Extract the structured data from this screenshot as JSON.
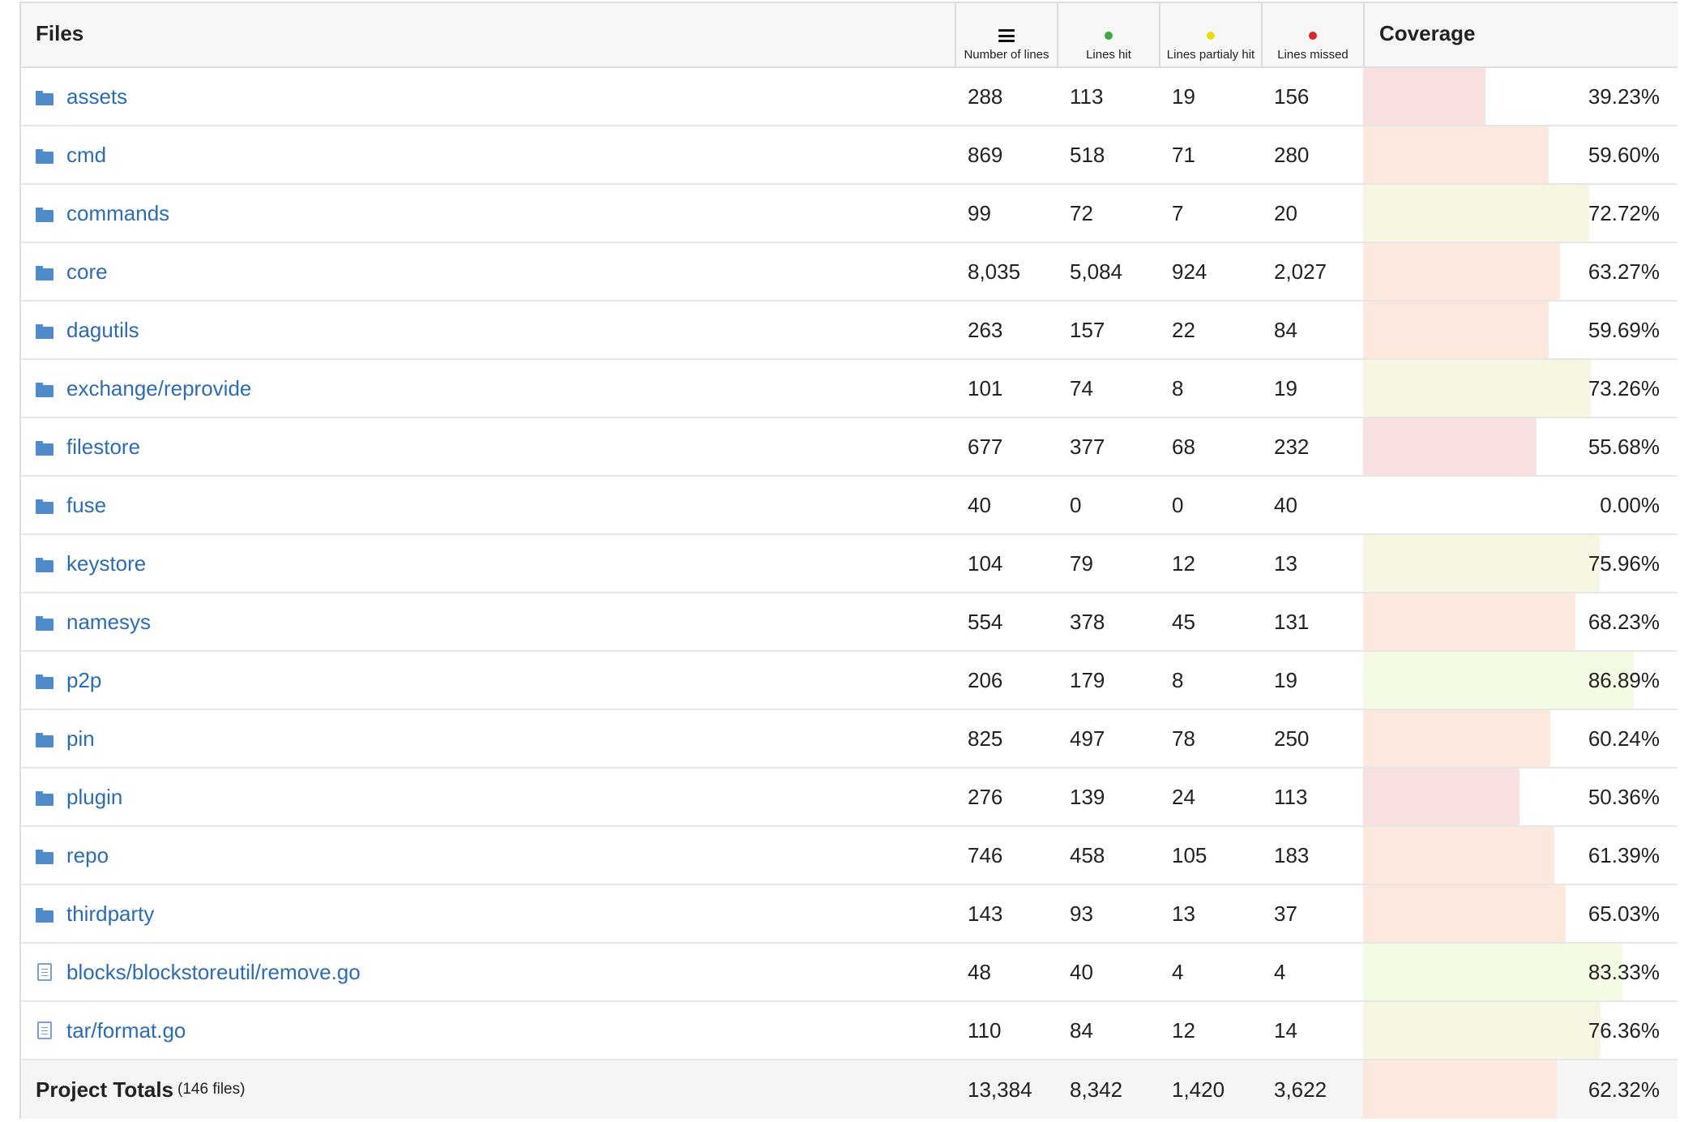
{
  "header": {
    "files": "Files",
    "number_of_lines": "Number of lines",
    "lines_hit": "Lines hit",
    "lines_partial": "Lines partialy hit",
    "lines_missed": "Lines missed",
    "coverage": "Coverage"
  },
  "colors": {
    "hit_dot": "#3aa83a",
    "partial_dot": "#f2d80e",
    "missed_dot": "#e02525",
    "link": "#2d6cb0",
    "bar_low": "#f8e0e0",
    "bar_mid": "#fde8de",
    "bar_high": "#f7f6e2",
    "bar_good": "#f3fbe4"
  },
  "rows": [
    {
      "icon": "folder-icon",
      "name": "assets",
      "lines": "288",
      "hit": "113",
      "partial": "19",
      "missed": "156",
      "coverage": "39.23%",
      "pct": 39.23
    },
    {
      "icon": "folder-icon",
      "name": "cmd",
      "lines": "869",
      "hit": "518",
      "partial": "71",
      "missed": "280",
      "coverage": "59.60%",
      "pct": 59.6
    },
    {
      "icon": "folder-icon",
      "name": "commands",
      "lines": "99",
      "hit": "72",
      "partial": "7",
      "missed": "20",
      "coverage": "72.72%",
      "pct": 72.72
    },
    {
      "icon": "folder-icon",
      "name": "core",
      "lines": "8,035",
      "hit": "5,084",
      "partial": "924",
      "missed": "2,027",
      "coverage": "63.27%",
      "pct": 63.27
    },
    {
      "icon": "folder-icon",
      "name": "dagutils",
      "lines": "263",
      "hit": "157",
      "partial": "22",
      "missed": "84",
      "coverage": "59.69%",
      "pct": 59.69
    },
    {
      "icon": "folder-icon",
      "name": "exchange/reprovide",
      "lines": "101",
      "hit": "74",
      "partial": "8",
      "missed": "19",
      "coverage": "73.26%",
      "pct": 73.26
    },
    {
      "icon": "folder-icon",
      "name": "filestore",
      "lines": "677",
      "hit": "377",
      "partial": "68",
      "missed": "232",
      "coverage": "55.68%",
      "pct": 55.68
    },
    {
      "icon": "folder-icon",
      "name": "fuse",
      "lines": "40",
      "hit": "0",
      "partial": "0",
      "missed": "40",
      "coverage": "0.00%",
      "pct": 0
    },
    {
      "icon": "folder-icon",
      "name": "keystore",
      "lines": "104",
      "hit": "79",
      "partial": "12",
      "missed": "13",
      "coverage": "75.96%",
      "pct": 75.96
    },
    {
      "icon": "folder-icon",
      "name": "namesys",
      "lines": "554",
      "hit": "378",
      "partial": "45",
      "missed": "131",
      "coverage": "68.23%",
      "pct": 68.23
    },
    {
      "icon": "folder-icon",
      "name": "p2p",
      "lines": "206",
      "hit": "179",
      "partial": "8",
      "missed": "19",
      "coverage": "86.89%",
      "pct": 86.89
    },
    {
      "icon": "folder-icon",
      "name": "pin",
      "lines": "825",
      "hit": "497",
      "partial": "78",
      "missed": "250",
      "coverage": "60.24%",
      "pct": 60.24
    },
    {
      "icon": "folder-icon",
      "name": "plugin",
      "lines": "276",
      "hit": "139",
      "partial": "24",
      "missed": "113",
      "coverage": "50.36%",
      "pct": 50.36
    },
    {
      "icon": "folder-icon",
      "name": "repo",
      "lines": "746",
      "hit": "458",
      "partial": "105",
      "missed": "183",
      "coverage": "61.39%",
      "pct": 61.39
    },
    {
      "icon": "folder-icon",
      "name": "thirdparty",
      "lines": "143",
      "hit": "93",
      "partial": "13",
      "missed": "37",
      "coverage": "65.03%",
      "pct": 65.03
    },
    {
      "icon": "file-icon",
      "name": "blocks/blockstoreutil/remove.go",
      "lines": "48",
      "hit": "40",
      "partial": "4",
      "missed": "4",
      "coverage": "83.33%",
      "pct": 83.33
    },
    {
      "icon": "file-icon",
      "name": "tar/format.go",
      "lines": "110",
      "hit": "84",
      "partial": "12",
      "missed": "14",
      "coverage": "76.36%",
      "pct": 76.36
    }
  ],
  "totals": {
    "label": "Project Totals",
    "sub": "(146 files)",
    "lines": "13,384",
    "hit": "8,342",
    "partial": "1,420",
    "missed": "3,622",
    "coverage": "62.32%",
    "pct": 62.32
  }
}
